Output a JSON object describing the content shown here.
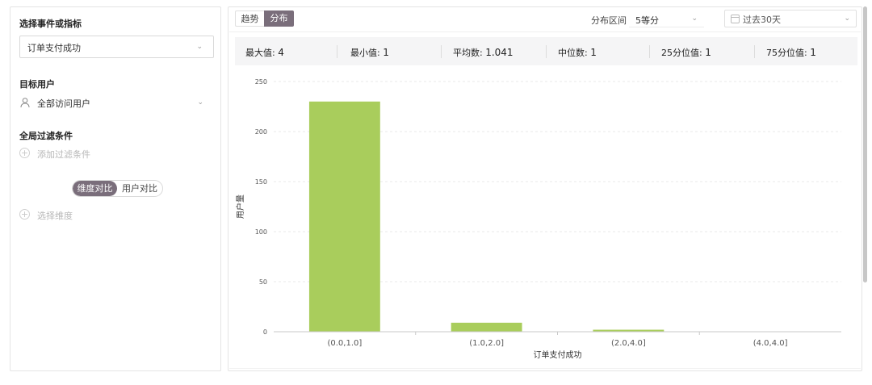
{
  "left": {
    "event_title": "选择事件或指标",
    "event_value": "订单支付成功",
    "target_title": "目标用户",
    "target_value": "全部访问用户",
    "filter_title": "全局过滤条件",
    "add_filter": "添加过滤条件",
    "compare_tabs": [
      "维度对比",
      "用户对比"
    ],
    "add_dimension": "选择维度"
  },
  "toolbar": {
    "view_tabs": [
      "趋势",
      "分布"
    ],
    "active_view": "分布",
    "range_label": "分布区间",
    "range_value": "5等分",
    "date_value": "过去30天"
  },
  "stats": [
    {
      "label": "最大值: ",
      "value": "4"
    },
    {
      "label": "最小值: ",
      "value": "1"
    },
    {
      "label": "平均数: ",
      "value": "1.041"
    },
    {
      "label": "中位数: ",
      "value": "1"
    },
    {
      "label": "25分位值: ",
      "value": "1"
    },
    {
      "label": "75分位值: ",
      "value": "1"
    }
  ],
  "chart_data": {
    "type": "bar",
    "categories": [
      "(0.0,1.0]",
      "(1.0,2.0]",
      "(2.0,4.0]",
      "(4.0,4.0]"
    ],
    "values": [
      230,
      9,
      2,
      0
    ],
    "ylabel": "用户量",
    "xlabel": "订单支付成功",
    "yticks": [
      0,
      50,
      100,
      150,
      200,
      250
    ],
    "ylim": [
      0,
      250
    ],
    "bar_color": "#a9cd5c",
    "grid": true
  },
  "colors": {
    "accent": "#7a6e7b",
    "bar": "#a9cd5c"
  }
}
